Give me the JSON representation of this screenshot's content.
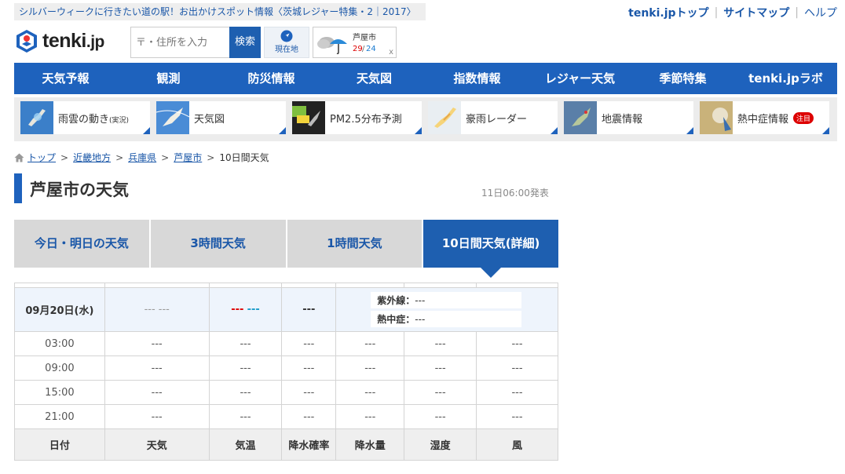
{
  "promo": {
    "text": "シルバーウィークに行きたい道の駅！お出かけスポット情報〈茨城レジャー特集・2｜2017〉"
  },
  "toplinks": {
    "home": "tenki.jpトップ",
    "sitemap": "サイトマップ",
    "help": "ヘルプ"
  },
  "logo": {
    "name": "tenki",
    "suffix": ".jp"
  },
  "search": {
    "placeholder": "〒・住所を入力",
    "button": "検索"
  },
  "location": {
    "label": "現在地"
  },
  "mini_weather": {
    "city": "芦屋市",
    "high": "29",
    "low": "24",
    "close": "x"
  },
  "mainnav": [
    "天気予報",
    "観測",
    "防災情報",
    "天気図",
    "指数情報",
    "レジャー天気",
    "季節特集",
    "tenki.jpラボ"
  ],
  "subnav": [
    {
      "label": "雨雲の動き",
      "small": "(実況)"
    },
    {
      "label": "天気図",
      "small": ""
    },
    {
      "label": "PM2.5分布予測",
      "small": ""
    },
    {
      "label": "豪雨レーダー",
      "small": ""
    },
    {
      "label": "地震情報",
      "small": ""
    },
    {
      "label": "熱中症情報",
      "small": "",
      "badge": "注目"
    }
  ],
  "breadcrumb": {
    "items": [
      "トップ",
      "近畿地方",
      "兵庫県",
      "芦屋市"
    ],
    "current": "10日間天気",
    "sep": ">"
  },
  "page": {
    "title": "芦屋市の天気",
    "announce": "11日06:00発表"
  },
  "tabs": [
    "今日・明日の天気",
    "3時間天気",
    "1時間天気",
    "10日間天気(詳細)"
  ],
  "table": {
    "day": {
      "date": "09月20日(水)",
      "weather": "--- ---",
      "temp_high": "---",
      "temp_low": "---",
      "precip": "---",
      "uv_label": "紫外線：",
      "uv_value": "---",
      "heat_label": "熱中症：",
      "heat_value": "---"
    },
    "rows": [
      {
        "time": "03:00",
        "weather": "---",
        "temp": "---",
        "prob": "---",
        "amount": "---",
        "humidity": "---",
        "wind": "---"
      },
      {
        "time": "09:00",
        "weather": "---",
        "temp": "---",
        "prob": "---",
        "amount": "---",
        "humidity": "---",
        "wind": "---"
      },
      {
        "time": "15:00",
        "weather": "---",
        "temp": "---",
        "prob": "---",
        "amount": "---",
        "humidity": "---",
        "wind": "---"
      },
      {
        "time": "21:00",
        "weather": "---",
        "temp": "---",
        "prob": "---",
        "amount": "---",
        "humidity": "---",
        "wind": "---"
      }
    ],
    "headers": [
      "日付",
      "天気",
      "気温",
      "降水確率",
      "降水量",
      "湿度",
      "風"
    ]
  }
}
